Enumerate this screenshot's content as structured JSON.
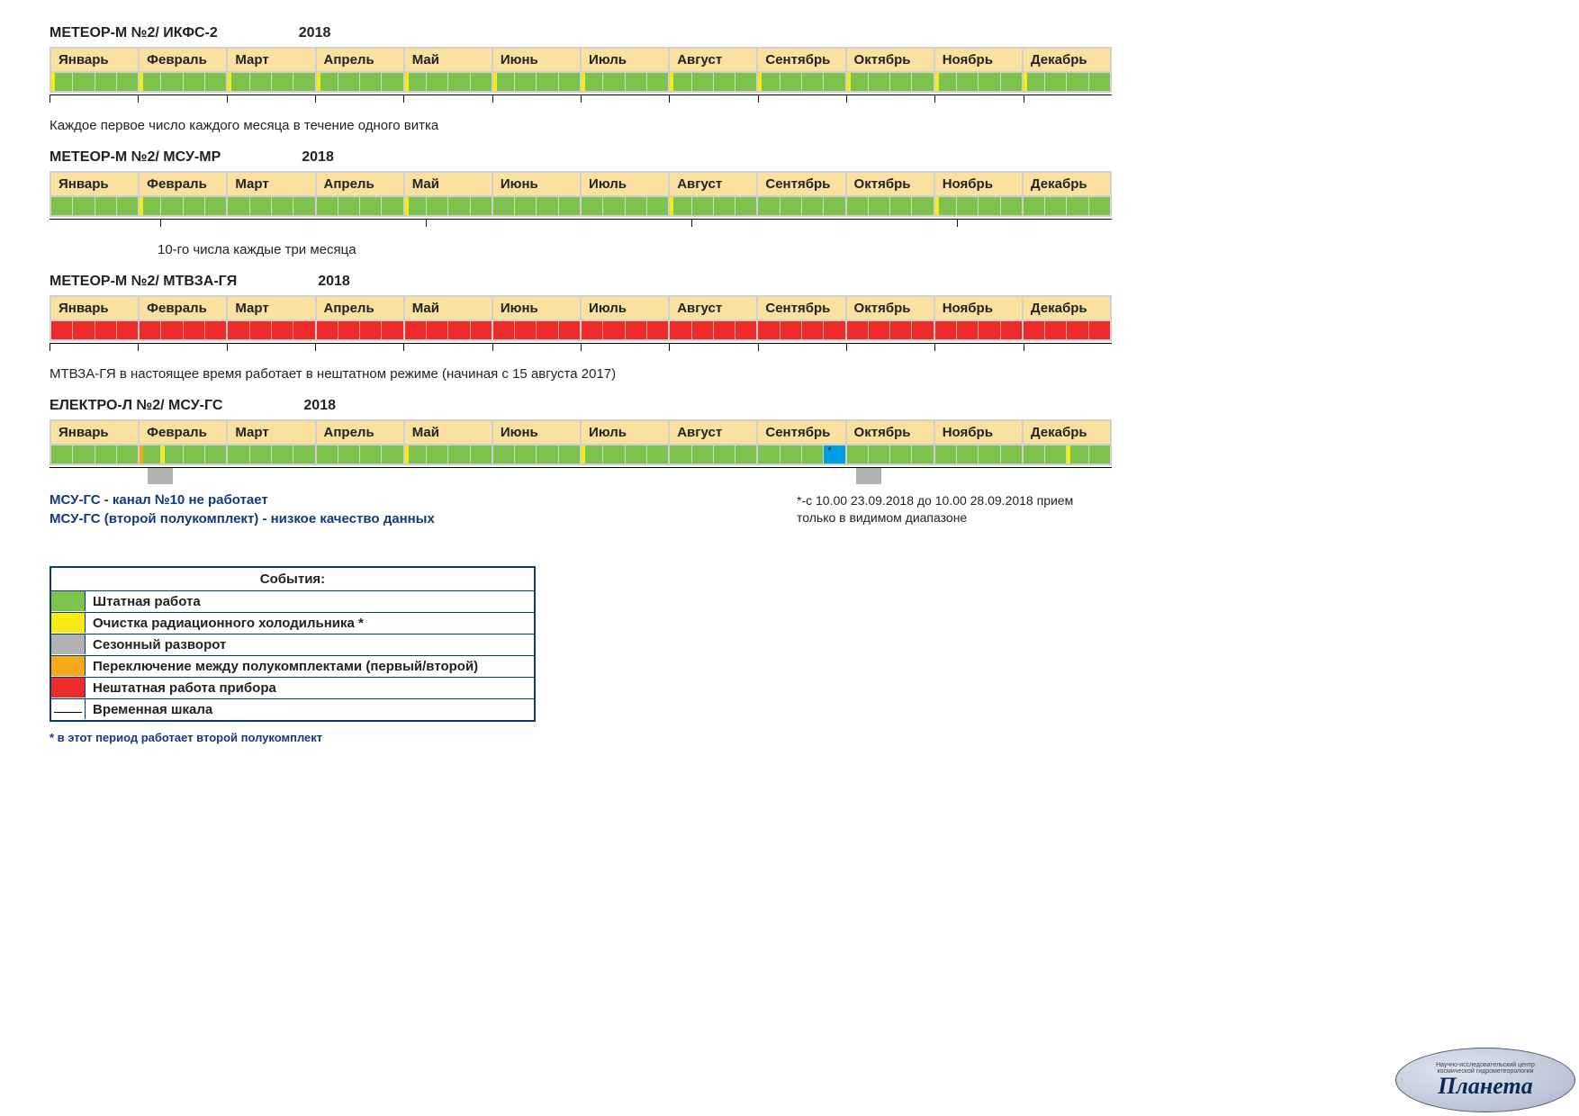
{
  "months": [
    "Январь",
    "Февраль",
    "Март",
    "Апрель",
    "Май",
    "Июнь",
    "Июль",
    "Август",
    "Сентябрь",
    "Октябрь",
    "Ноябрь",
    "Декабрь"
  ],
  "chart_data": [
    {
      "id": "ikfs2",
      "title": "МЕТЕОР-М №2/ ИКФС-2",
      "year": "2018",
      "type": "timeline",
      "note": "Каждое первое число каждого месяца в течение одного витка",
      "ticks": "all",
      "cells": [
        [
          "gy",
          "g",
          "g",
          "g"
        ],
        [
          "gy",
          "g",
          "g",
          "g"
        ],
        [
          "gy",
          "g",
          "g",
          "g"
        ],
        [
          "gy",
          "g",
          "g",
          "g"
        ],
        [
          "gy",
          "g",
          "g",
          "g"
        ],
        [
          "gy",
          "g",
          "g",
          "g"
        ],
        [
          "gy",
          "g",
          "g",
          "g"
        ],
        [
          "gy",
          "g",
          "g",
          "g"
        ],
        [
          "gy",
          "g",
          "g",
          "g"
        ],
        [
          "gy",
          "g",
          "g",
          "g"
        ],
        [
          "gy",
          "g",
          "g",
          "g"
        ],
        [
          "gy",
          "g",
          "g",
          "g"
        ]
      ]
    },
    {
      "id": "msumr",
      "title": "МЕТЕОР-М №2/ МСУ-МР",
      "year": "2018",
      "type": "timeline",
      "note": "10-го числа каждые три месяца",
      "note_indent": true,
      "ticks": [
        1,
        4,
        7,
        10
      ],
      "cells": [
        [
          "g",
          "g",
          "g",
          "g"
        ],
        [
          "gy",
          "g",
          "g",
          "g"
        ],
        [
          "g",
          "g",
          "g",
          "g"
        ],
        [
          "g",
          "g",
          "g",
          "g"
        ],
        [
          "gy",
          "g",
          "g",
          "g"
        ],
        [
          "g",
          "g",
          "g",
          "g"
        ],
        [
          "g",
          "g",
          "g",
          "g"
        ],
        [
          "gy",
          "g",
          "g",
          "g"
        ],
        [
          "g",
          "g",
          "g",
          "g"
        ],
        [
          "g",
          "g",
          "g",
          "g"
        ],
        [
          "gy",
          "g",
          "g",
          "g"
        ],
        [
          "g",
          "g",
          "g",
          "g"
        ]
      ]
    },
    {
      "id": "mtvza",
      "title": "МЕТЕОР-М №2/ МТВЗА-ГЯ",
      "year": "2018",
      "type": "timeline",
      "note": "МТВЗА-ГЯ в настоящее время работает в нештатном режиме (начиная с 15 августа 2017)",
      "ticks": "all",
      "cells": [
        [
          "r",
          "r",
          "r",
          "r"
        ],
        [
          "r",
          "r",
          "r",
          "r"
        ],
        [
          "r",
          "r",
          "r",
          "r"
        ],
        [
          "r",
          "r",
          "r",
          "r"
        ],
        [
          "r",
          "r",
          "r",
          "r"
        ],
        [
          "r",
          "r",
          "r",
          "r"
        ],
        [
          "r",
          "r",
          "r",
          "r"
        ],
        [
          "r",
          "r",
          "r",
          "r"
        ],
        [
          "r",
          "r",
          "r",
          "r"
        ],
        [
          "r",
          "r",
          "r",
          "r"
        ],
        [
          "r",
          "r",
          "r",
          "r"
        ],
        [
          "r",
          "r",
          "r",
          "r"
        ]
      ]
    },
    {
      "id": "msugs",
      "title": "ЕЛЕКТРО-Л  №2/ МСУ-ГС",
      "year": "2018",
      "type": "timeline",
      "ticks": [
        1,
        9
      ],
      "tick_marker": "square",
      "cells": [
        [
          "g",
          "g",
          "g",
          "g"
        ],
        [
          "go",
          "gy",
          "g",
          "g"
        ],
        [
          "g",
          "g",
          "g",
          "g"
        ],
        [
          "g",
          "g",
          "g",
          "g"
        ],
        [
          "gy",
          "g",
          "g",
          "g"
        ],
        [
          "g",
          "g",
          "g",
          "g"
        ],
        [
          "gy",
          "g",
          "g",
          "g"
        ],
        [
          "g",
          "g",
          "g",
          "g"
        ],
        [
          "g",
          "g",
          "g",
          "b*"
        ],
        [
          "g",
          "g",
          "g",
          "g"
        ],
        [
          "g",
          "g",
          "g",
          "g"
        ],
        [
          "g",
          "g",
          "gy",
          "g"
        ]
      ]
    }
  ],
  "msugs_notes": {
    "line1": "МСУ-ГС - канал №10 не работает",
    "line2": "МСУ-ГС (второй полукомплект) - низкое качество данных"
  },
  "side_note": "*-с 10.00  23.09.2018 до 10.00 28.09.2018 прием только в видимом диапазоне",
  "legend": {
    "title": "События:",
    "items": [
      {
        "color": "green",
        "label": "Штатная работа"
      },
      {
        "color": "yellow",
        "label": "Очистка радиационного холодильника *"
      },
      {
        "color": "gray",
        "label": "Сезонный разворот"
      },
      {
        "color": "orange",
        "label": "Переключение между полукомплектами (первый/второй)"
      },
      {
        "color": "red",
        "label": "Нештатная работа прибора"
      },
      {
        "color": "line",
        "label": "Временная шкала"
      }
    ]
  },
  "legend_footnote": "* в этот период работает второй полукомплект",
  "logo": {
    "line1": "Научно-исследовательский центр",
    "line2": "космической гидрометеорологии",
    "brand": "Планета"
  },
  "cell_codes": {
    "g": "green – штатная работа",
    "gy": "green с жёлтой меткой в начале ячейки (очистка радиационного холодильника)",
    "go": "green с оранжевой меткой (переключение полукомплектов)",
    "r": "red – нештатная работа",
    "b*": "blue – особое событие со сноской *"
  }
}
